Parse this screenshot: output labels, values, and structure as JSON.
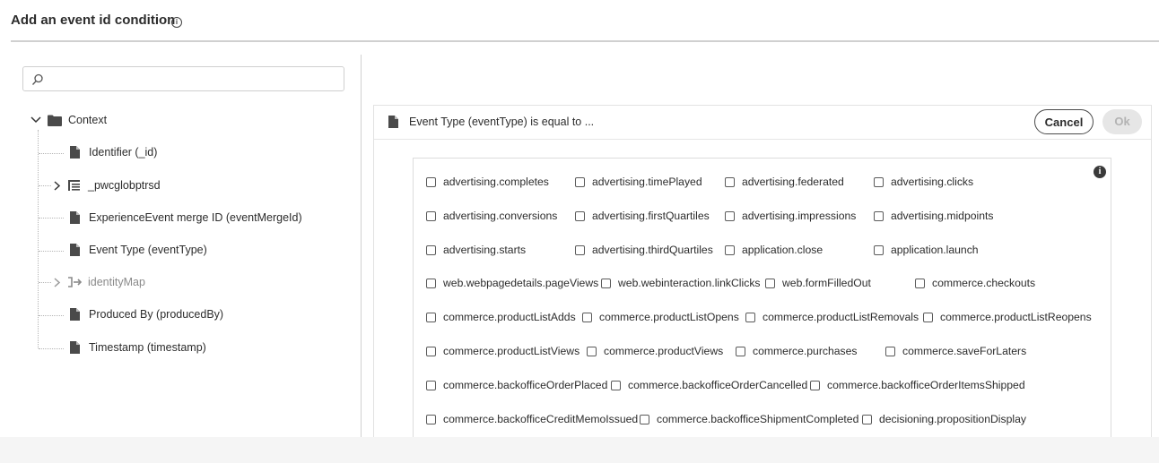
{
  "header": {
    "title": "Add an event id condition",
    "info_icon": "info-icon"
  },
  "search": {
    "placeholder": "",
    "value": ""
  },
  "tree": {
    "root": {
      "label": "Context"
    },
    "items": [
      {
        "label": "Identifier (_id)"
      },
      {
        "label": "_pwcglobptrsd"
      },
      {
        "label": "ExperienceEvent merge ID (eventMergeId)"
      },
      {
        "label": "Event Type (eventType)"
      },
      {
        "label": "identityMap"
      },
      {
        "label": "Produced By (producedBy)"
      },
      {
        "label": "Timestamp (timestamp)"
      }
    ]
  },
  "condition": {
    "header": "Event Type (eventType) is equal to ...",
    "cancel_label": "Cancel",
    "ok_label": "Ok"
  },
  "options": [
    [
      "advertising.completes",
      "advertising.timePlayed",
      "advertising.federated",
      "advertising.clicks"
    ],
    [
      "advertising.conversions",
      "advertising.firstQuartiles",
      "advertising.impressions",
      "advertising.midpoints"
    ],
    [
      "advertising.starts",
      "advertising.thirdQuartiles",
      "application.close",
      "application.launch"
    ],
    [
      "web.webpagedetails.pageViews",
      "web.webinteraction.linkClicks",
      "web.formFilledOut",
      "commerce.checkouts"
    ],
    [
      "commerce.productListAdds",
      "commerce.productListOpens",
      "commerce.productListRemovals",
      "commerce.productListReopens"
    ],
    [
      "commerce.productListViews",
      "commerce.productViews",
      "commerce.purchases",
      "commerce.saveForLaters"
    ],
    [
      "commerce.backofficeOrderPlaced",
      "commerce.backofficeOrderCancelled",
      "commerce.backofficeOrderItemsShipped"
    ],
    [
      "commerce.backofficeCreditMemoIssued",
      "commerce.backofficeShipmentCompleted",
      "decisioning.propositionDisplay"
    ]
  ]
}
